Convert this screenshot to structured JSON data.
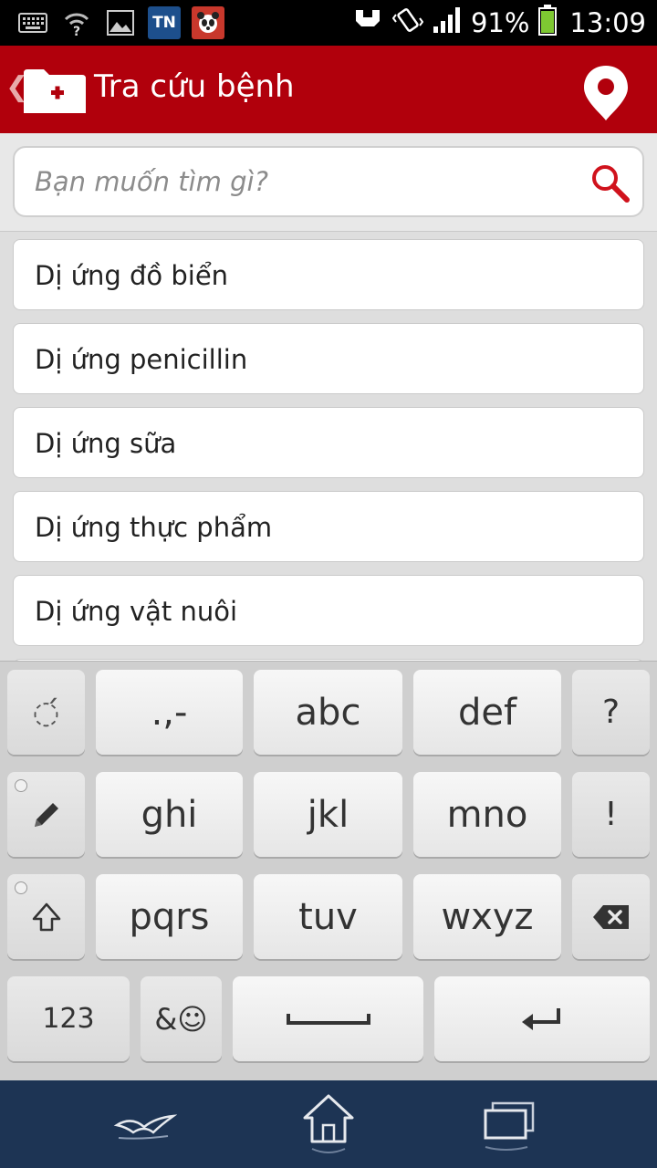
{
  "status_bar": {
    "left_icons": [
      "keyboard-icon",
      "wifi-question-icon",
      "image-icon",
      "tn-app-icon",
      "panda-app-icon"
    ],
    "tn_label": "TN",
    "right_icons": [
      "usb-debug-icon",
      "vibrate-icon",
      "signal-icon",
      "battery-icon"
    ],
    "battery": "91%",
    "time": "13:09"
  },
  "app_bar": {
    "back_glyph": "❮",
    "title": "Tra cứu bệnh",
    "background": "#b1000c"
  },
  "search": {
    "placeholder": "Bạn muốn tìm gì?",
    "value": "",
    "icon_color": "#d0121c"
  },
  "results": [
    {
      "label": "Dị ứng đồ biển"
    },
    {
      "label": "Dị ứng penicillin"
    },
    {
      "label": "Dị ứng sữa"
    },
    {
      "label": "Dị ứng thực phẩm"
    },
    {
      "label": "Dị ứng vật nuôi"
    }
  ],
  "keyboard": {
    "row1": {
      "accent": "◌́",
      "punct": ".,-",
      "k2": "abc",
      "k3": "def",
      "q": "?"
    },
    "row2": {
      "k4": "ghi",
      "k5": "jkl",
      "k6": "mno",
      "excl": "!"
    },
    "row3": {
      "k7": "pqrs",
      "k8": "tuv",
      "k9": "wxyz"
    },
    "row4": {
      "num": "123",
      "symbols": "&☺"
    }
  },
  "nav_bar": {
    "buttons": [
      "back-icon",
      "home-icon",
      "recent-apps-icon"
    ],
    "background": "#1d3454"
  }
}
